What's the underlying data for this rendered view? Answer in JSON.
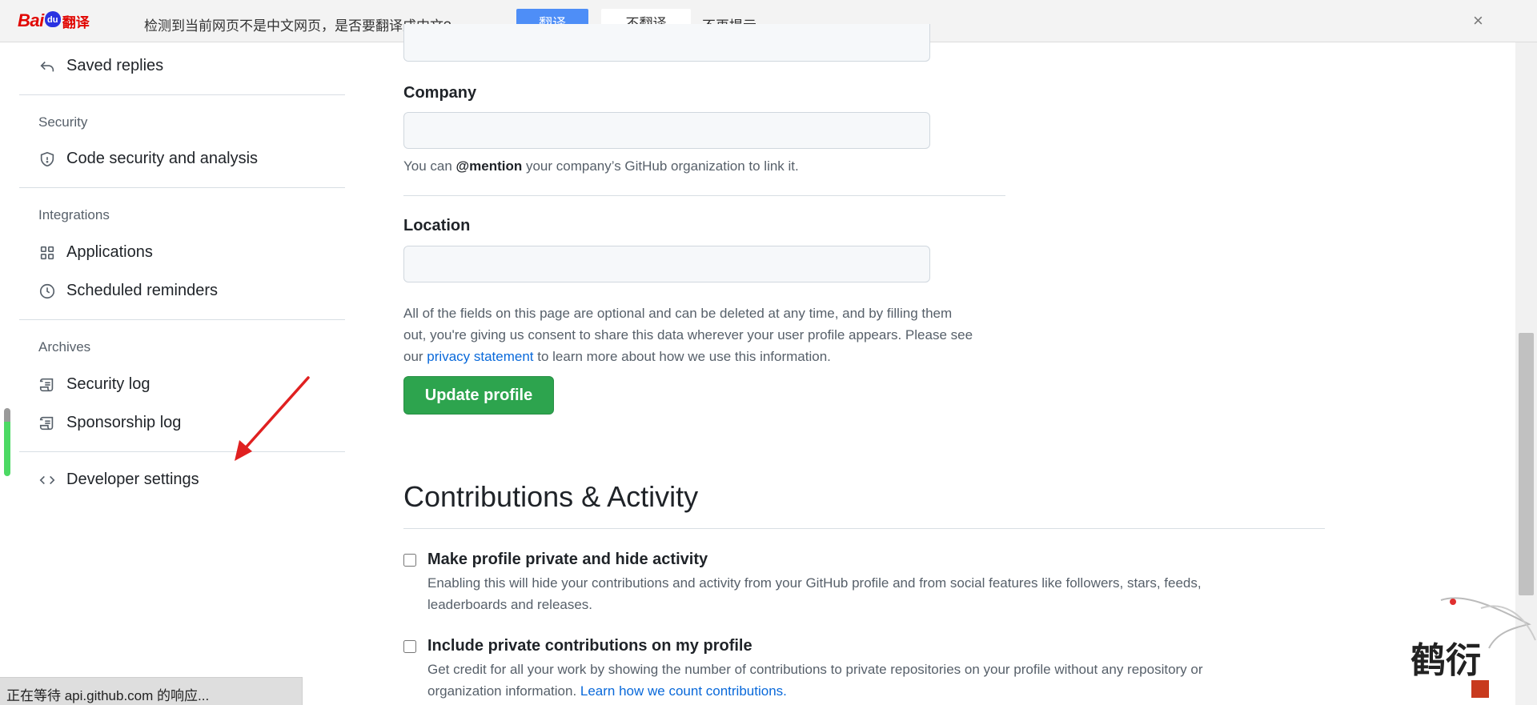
{
  "translate_bar": {
    "logo_bai": "Bai",
    "logo_du": "du",
    "logo_fanyi": "翻译",
    "message": "检测到当前网页不是中文网页，是否要翻译成中文?",
    "translate_button": "翻译",
    "no_translate_button": "不翻译",
    "never_prompt": "不再提示",
    "close_symbol": "×"
  },
  "sidebar": {
    "saved_replies": "Saved replies",
    "security_heading": "Security",
    "code_security": "Code security and analysis",
    "integrations_heading": "Integrations",
    "applications": "Applications",
    "scheduled_reminders": "Scheduled reminders",
    "archives_heading": "Archives",
    "security_log": "Security log",
    "sponsorship_log": "Sponsorship log",
    "developer_settings": "Developer settings"
  },
  "form": {
    "company_label": "Company",
    "company_value": "",
    "company_note_pre": "You can ",
    "company_note_mention": "@mention",
    "company_note_post": " your company’s GitHub organization to link it.",
    "location_label": "Location",
    "location_value": "",
    "consent_line1": "All of the fields on this page are optional and can be deleted at any time, and by filling them",
    "consent_line2": "out, you're giving us consent to share this data wherever your user profile appears. Please see",
    "consent_pre_link": "our ",
    "consent_link": "privacy statement",
    "consent_post_link": " to learn more about how we use this information.",
    "update_button": "Update profile"
  },
  "contributions": {
    "heading": "Contributions & Activity",
    "private_title": "Make profile private and hide activity",
    "private_desc": "Enabling this will hide your contributions and activity from your GitHub profile and from social features like followers, stars, feeds, leaderboards and releases.",
    "private_checked": false,
    "include_title": "Include private contributions on my profile",
    "include_desc": "Get credit for all your work by showing the number of contributions to private repositories on your profile without any repository or organization information. ",
    "include_link": "Learn how we count contributions.",
    "include_checked": false
  },
  "status_bar": {
    "text": "正在等待 api.github.com 的响应..."
  },
  "watermark": {
    "text": "鹤衍"
  },
  "colors": {
    "primary_button": "#2da44e",
    "link": "#0969da",
    "translate_button": "#4e8ef7",
    "arrow": "#e02020"
  }
}
